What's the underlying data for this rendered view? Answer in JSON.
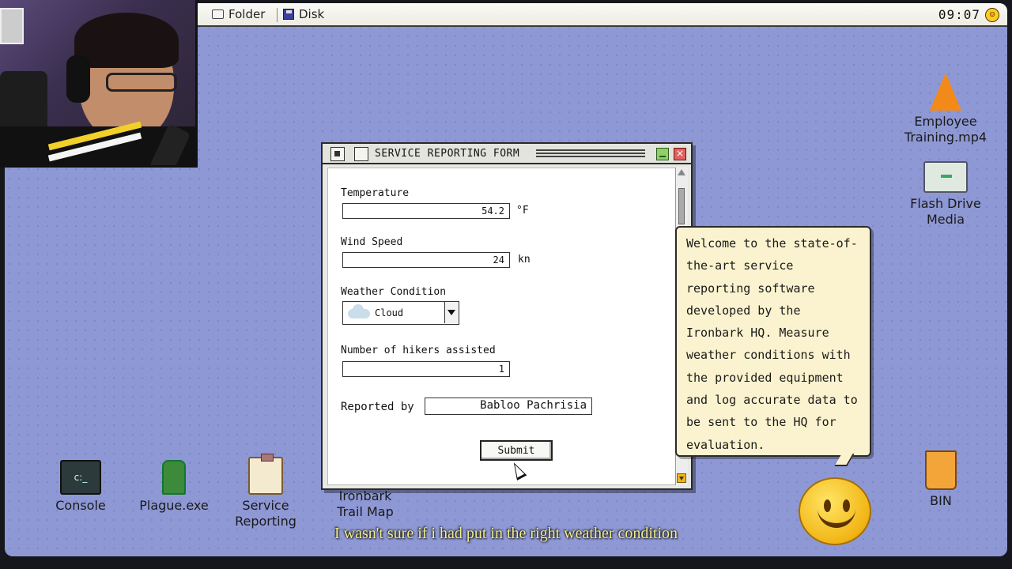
{
  "menubar": {
    "folder_label": "Folder",
    "disk_label": "Disk",
    "clock": "09:07"
  },
  "window": {
    "title": "SERVICE REPORTING FORM",
    "close_symbol": "×",
    "fields": {
      "temperature": {
        "label": "Temperature",
        "value": "54.2",
        "unit": "°F"
      },
      "wind_speed": {
        "label": "Wind Speed",
        "value": "24",
        "unit": "kn"
      },
      "weather_condition": {
        "label": "Weather Condition",
        "value": "Cloud"
      },
      "hikers_assisted": {
        "label": "Number of hikers assisted",
        "value": "1"
      },
      "reported_by": {
        "label": "Reported by",
        "value": "Babloo Pachrisia"
      }
    },
    "submit_label": "Submit"
  },
  "tooltip": {
    "text": "Welcome to the state-of-the-art service reporting software developed by the Ironbark HQ. Measure weather conditions with the provided equipment and log accurate data to be sent to the HQ for evaluation."
  },
  "desktop_icons": [
    {
      "label": "Console",
      "icon": "console-icon"
    },
    {
      "label": "Plague.exe",
      "icon": "cactus-icon"
    },
    {
      "label": "Service Reporting",
      "icon": "clipboard-icon"
    },
    {
      "label": "Ironbark Trail Map",
      "icon": "map-icon"
    },
    {
      "label": "Employee Training.mp4",
      "icon": "traffic-cone-icon"
    },
    {
      "label": "Flash Drive Media",
      "icon": "folder-icon"
    },
    {
      "label": "BIN",
      "icon": "trash-bin-icon"
    }
  ],
  "subtitle": "I wasn't sure if i had put in the right weather condition"
}
